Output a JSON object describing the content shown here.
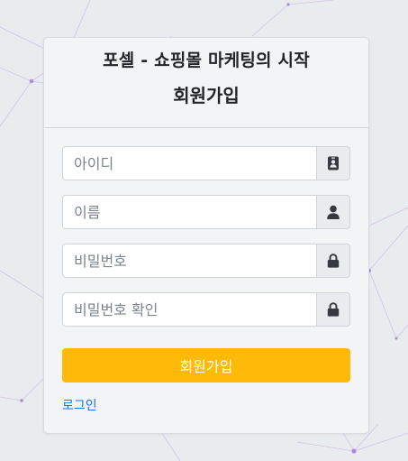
{
  "header": {
    "brand": "포셀 - 쇼핑몰 마케팅의 시작",
    "title": "회원가입"
  },
  "form": {
    "username": {
      "placeholder": "아이디",
      "icon": "id-badge-icon"
    },
    "name": {
      "placeholder": "이름",
      "icon": "user-icon"
    },
    "password": {
      "placeholder": "비밀번호",
      "icon": "lock-icon"
    },
    "password_confirm": {
      "placeholder": "비밀번호 확인",
      "icon": "lock-icon"
    },
    "submit_label": "회원가입"
  },
  "footer": {
    "login_link": "로그인"
  },
  "colors": {
    "primary_button": "#ffb908",
    "link": "#1a73e8",
    "network_lines": "#b79bdc"
  }
}
